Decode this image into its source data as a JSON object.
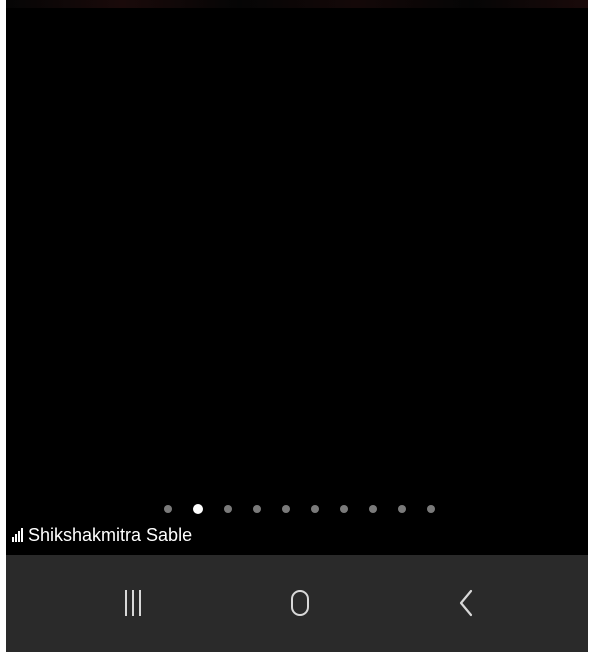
{
  "status_bar": {
    "carrier_name": "Shikshakmitra Sable",
    "signal_icon": "signal-bars-icon"
  },
  "pager": {
    "total_pages": 10,
    "active_index": 1
  },
  "nav_bar": {
    "recents_icon": "recents-icon",
    "home_icon": "home-icon",
    "back_icon": "back-chevron-icon"
  },
  "colors": {
    "screen_background": "#000000",
    "nav_bar_background": "#2a2a2a",
    "dot_inactive": "#7a7a7a",
    "dot_active": "#ffffff",
    "nav_icon": "#d8d8d8"
  }
}
